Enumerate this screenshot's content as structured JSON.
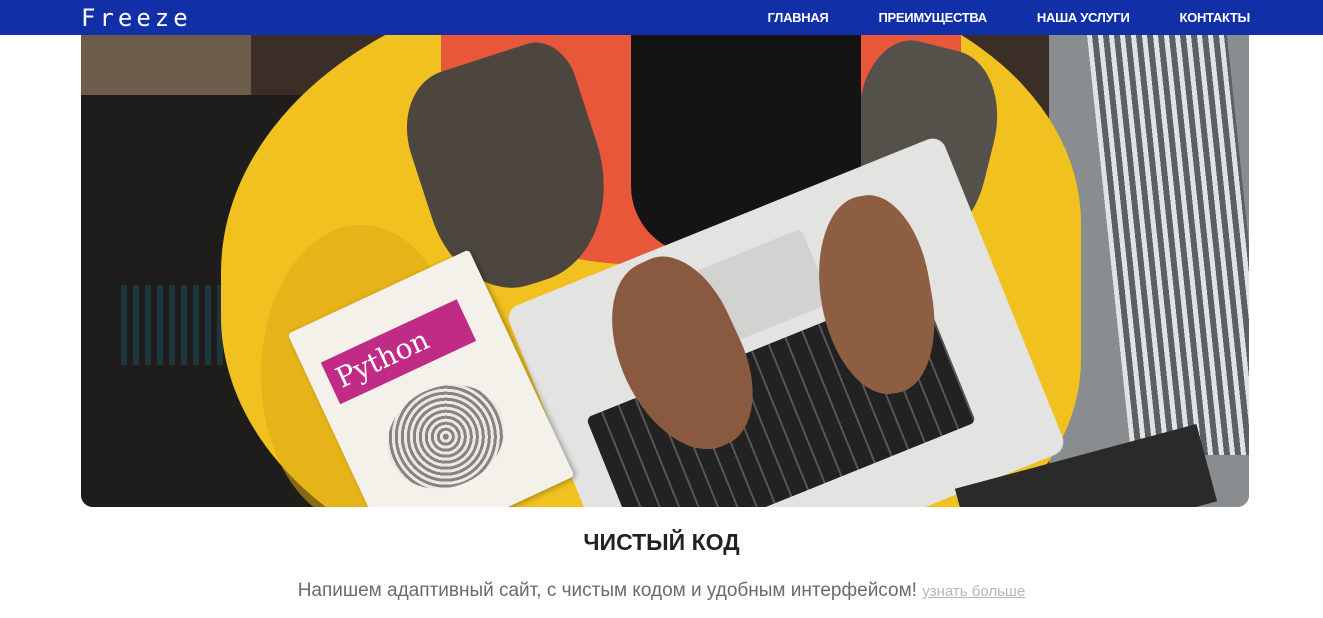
{
  "header": {
    "logo": "Freeze",
    "nav": [
      {
        "label": "ГЛАВНАЯ"
      },
      {
        "label": "ПРЕИМУЩЕСТВА"
      },
      {
        "label": "НАША УСЛУГИ"
      },
      {
        "label": "КОНТАКТЫ"
      }
    ],
    "background_color": "#1130a8"
  },
  "hero": {
    "book_title": "Python"
  },
  "section": {
    "title": "ЧИСТЫЙ КОД",
    "text": "Напишем адаптивный сайт, с чистым кодом и удобным интерфейсом!",
    "link": "узнать больше"
  }
}
